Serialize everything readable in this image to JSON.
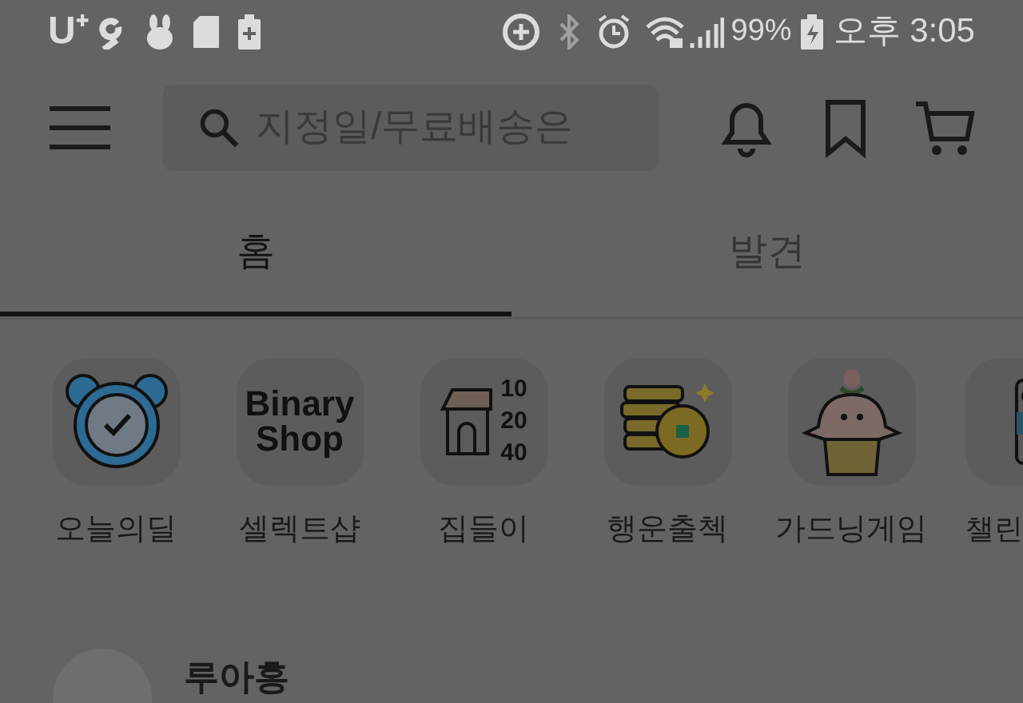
{
  "status_bar": {
    "carrier": "U⁺",
    "battery": "99%",
    "time": "오후 3:05"
  },
  "header": {
    "search": {
      "placeholder": "지정일/무료배송은"
    }
  },
  "tabs": [
    {
      "label": "홈",
      "selected": true
    },
    {
      "label": "발견",
      "selected": false
    }
  ],
  "shortcuts": [
    {
      "label": "오늘의딜",
      "kind": "clock"
    },
    {
      "label": "셀렉트샵",
      "kind": "logo",
      "logo_lines": [
        "Binary",
        "Shop"
      ]
    },
    {
      "label": "집들이",
      "kind": "house",
      "numbers": [
        "10",
        "20",
        "40"
      ]
    },
    {
      "label": "행운출첵",
      "kind": "coins"
    },
    {
      "label": "가드닝게임",
      "kind": "plant"
    },
    {
      "label": "챌린",
      "kind": "partial"
    }
  ],
  "post": {
    "author": "루아홍"
  }
}
